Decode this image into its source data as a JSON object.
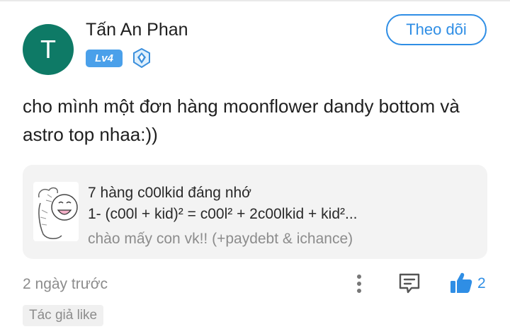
{
  "post": {
    "author": {
      "avatar_initial": "T",
      "name": "Tấn An Phan",
      "level": "Lv4",
      "rank_icon": "diamond-rank-icon"
    },
    "follow_label": "Theo dõi",
    "body": "cho mình một đơn hàng moonflower dandy bottom và astro top nhaa:))",
    "shared": {
      "title": "7 hàng c00lkid đáng nhớ",
      "description": "1- (c00l + kid)² = c00l² + 2c00lkid + kid²...",
      "subtitle": "chào mấy con vk!! (+paydebt & ichance)",
      "thumbnail_icon": "meme-face-thumbnail"
    },
    "timestamp": "2 ngày trước",
    "actions": {
      "more_icon": "more-vertical-icon",
      "comment_icon": "comment-icon",
      "like_icon": "thumbs-up-icon",
      "like_count": "2"
    },
    "author_like_label": "Tác giả like"
  },
  "colors": {
    "avatar_bg": "#0e7a66",
    "accent": "#2f8ee5",
    "level_badge": "#4aa0ea",
    "card_bg": "#f3f3f3",
    "muted_text": "#8c8c8c"
  }
}
